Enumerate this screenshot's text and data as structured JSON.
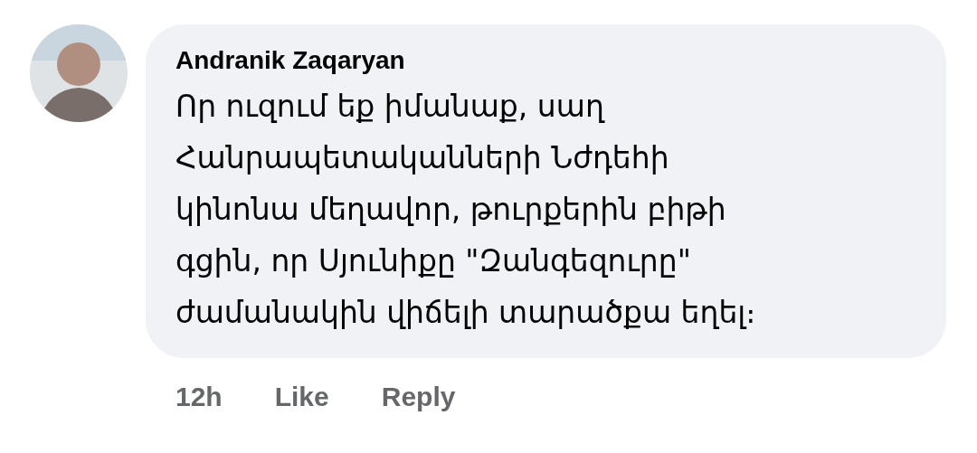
{
  "comment": {
    "author": "Andranik Zaqaryan",
    "text": "Որ ուզում եք իմանաք, սաղ\nՀանրապետականների Նժդեհի\nկինոնա մեղավոր, թուրքերին բիթի\nգցին, որ Սյունիքը \"Զանգեզուրը\"\nժամանակին վիճելի տարածքա եղել։",
    "time": "12h",
    "actions": [
      "Like",
      "Reply"
    ]
  }
}
